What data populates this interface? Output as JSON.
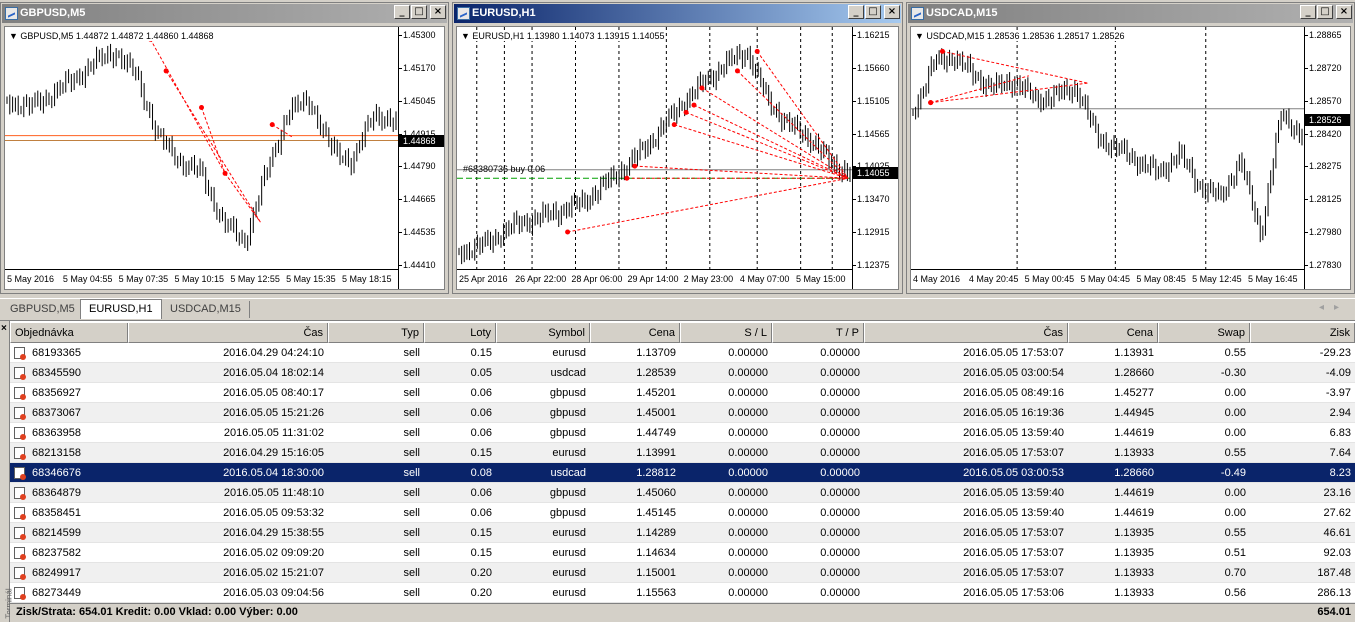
{
  "colors": {
    "title_active": "#0a246a",
    "title_inactive": "#808080",
    "selected_row": "#0a246a",
    "order_marker": "#ff0000",
    "price_line_gbp": "#ff6020"
  },
  "windows": [
    {
      "title": "GBPUSD,M5",
      "header": "GBPUSD,M5  1.44872 1.44872 1.44860 1.44868",
      "current_price": "1.44868",
      "y_labels": [
        "1.45300",
        "1.45170",
        "1.45045",
        "1.44915",
        "1.44790",
        "1.44665",
        "1.44535",
        "1.44410"
      ],
      "x_labels": [
        "5 May 2016",
        "5 May 04:55",
        "5 May 07:35",
        "5 May 10:15",
        "5 May 12:55",
        "5 May 15:35",
        "5 May 18:15"
      ]
    },
    {
      "title": "EURUSD,H1",
      "header": "EURUSD,H1  1.13980 1.14073 1.13915 1.14055",
      "current_price": "1.14055",
      "order_label": "#68380736 buy 0.06",
      "y_labels": [
        "1.16215",
        "1.15660",
        "1.15105",
        "1.14565",
        "1.14025",
        "1.13470",
        "1.12915",
        "1.12375"
      ],
      "x_labels": [
        "25 Apr 2016",
        "26 Apr 22:00",
        "28 Apr 06:00",
        "29 Apr 14:00",
        "2 May 23:00",
        "4 May 07:00",
        "5 May 15:00"
      ]
    },
    {
      "title": "USDCAD,M15",
      "header": "USDCAD,M15  1.28536 1.28536 1.28517 1.28526",
      "current_price": "1.28526",
      "y_labels": [
        "1.28865",
        "1.28720",
        "1.28570",
        "1.28420",
        "1.28275",
        "1.28125",
        "1.27980",
        "1.27830"
      ],
      "x_labels": [
        "4 May 2016",
        "4 May 20:45",
        "5 May 00:45",
        "5 May 04:45",
        "5 May 08:45",
        "5 May 12:45",
        "5 May 16:45"
      ]
    }
  ],
  "tabs": [
    "GBPUSD,M5",
    "EURUSD,H1",
    "USDCAD,M15"
  ],
  "active_tab": 1,
  "table": {
    "headers": [
      "Objednávka",
      "Čas",
      "Typ",
      "Loty",
      "Symbol",
      "Cena",
      "S / L",
      "T / P",
      "Čas",
      "Cena",
      "Swap",
      "Zisk"
    ],
    "rows": [
      [
        "68193365",
        "2016.04.29 04:24:10",
        "sell",
        "0.15",
        "eurusd",
        "1.13709",
        "0.00000",
        "0.00000",
        "2016.05.05 17:53:07",
        "1.13931",
        "0.55",
        "-29.23"
      ],
      [
        "68345590",
        "2016.05.04 18:02:14",
        "sell",
        "0.05",
        "usdcad",
        "1.28539",
        "0.00000",
        "0.00000",
        "2016.05.05 03:00:54",
        "1.28660",
        "-0.30",
        "-4.09"
      ],
      [
        "68356927",
        "2016.05.05 08:40:17",
        "sell",
        "0.06",
        "gbpusd",
        "1.45201",
        "0.00000",
        "0.00000",
        "2016.05.05 08:49:16",
        "1.45277",
        "0.00",
        "-3.97"
      ],
      [
        "68373067",
        "2016.05.05 15:21:26",
        "sell",
        "0.06",
        "gbpusd",
        "1.45001",
        "0.00000",
        "0.00000",
        "2016.05.05 16:19:36",
        "1.44945",
        "0.00",
        "2.94"
      ],
      [
        "68363958",
        "2016.05.05 11:31:02",
        "sell",
        "0.06",
        "gbpusd",
        "1.44749",
        "0.00000",
        "0.00000",
        "2016.05.05 13:59:40",
        "1.44619",
        "0.00",
        "6.83"
      ],
      [
        "68213158",
        "2016.04.29 15:16:05",
        "sell",
        "0.15",
        "eurusd",
        "1.13991",
        "0.00000",
        "0.00000",
        "2016.05.05 17:53:07",
        "1.13933",
        "0.55",
        "7.64"
      ],
      [
        "68346676",
        "2016.05.04 18:30:00",
        "sell",
        "0.08",
        "usdcad",
        "1.28812",
        "0.00000",
        "0.00000",
        "2016.05.05 03:00:53",
        "1.28660",
        "-0.49",
        "8.23"
      ],
      [
        "68364879",
        "2016.05.05 11:48:10",
        "sell",
        "0.06",
        "gbpusd",
        "1.45060",
        "0.00000",
        "0.00000",
        "2016.05.05 13:59:40",
        "1.44619",
        "0.00",
        "23.16"
      ],
      [
        "68358451",
        "2016.05.05 09:53:32",
        "sell",
        "0.06",
        "gbpusd",
        "1.45145",
        "0.00000",
        "0.00000",
        "2016.05.05 13:59:40",
        "1.44619",
        "0.00",
        "27.62"
      ],
      [
        "68214599",
        "2016.04.29 15:38:55",
        "sell",
        "0.15",
        "eurusd",
        "1.14289",
        "0.00000",
        "0.00000",
        "2016.05.05 17:53:07",
        "1.13935",
        "0.55",
        "46.61"
      ],
      [
        "68237582",
        "2016.05.02 09:09:20",
        "sell",
        "0.15",
        "eurusd",
        "1.14634",
        "0.00000",
        "0.00000",
        "2016.05.05 17:53:07",
        "1.13935",
        "0.51",
        "92.03"
      ],
      [
        "68249917",
        "2016.05.02 15:21:07",
        "sell",
        "0.20",
        "eurusd",
        "1.15001",
        "0.00000",
        "0.00000",
        "2016.05.05 17:53:07",
        "1.13933",
        "0.70",
        "187.48"
      ],
      [
        "68273449",
        "2016.05.03 09:04:56",
        "sell",
        "0.20",
        "eurusd",
        "1.15563",
        "0.00000",
        "0.00000",
        "2016.05.05 17:53:06",
        "1.13933",
        "0.56",
        "286.13"
      ]
    ],
    "selected_row": 6
  },
  "summary": {
    "text": "Zisk/Strata: 654.01  Kredit: 0.00  Vklad: 0.00  Výber: 0.00",
    "total": "654.01"
  },
  "side_strip_label": "Terminál"
}
